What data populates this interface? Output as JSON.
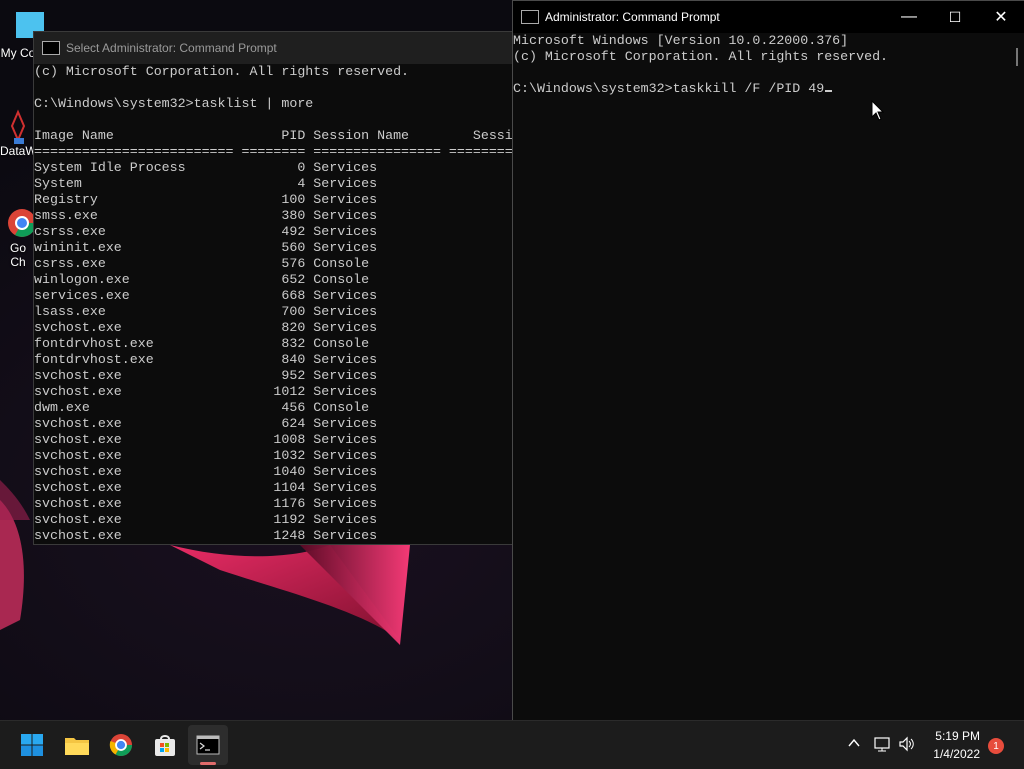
{
  "desktop": {
    "icons": [
      {
        "label": "My Co",
        "icon": "monitor-icon"
      },
      {
        "label": "DataW",
        "icon": "datawrapper-icon"
      },
      {
        "label": "Go",
        "label2": "Ch",
        "icon": "chrome-icon"
      }
    ]
  },
  "back_window": {
    "title": "Select Administrator: Command Prompt",
    "lines": [
      "(c) Microsoft Corporation. All rights reserved.",
      "",
      "C:\\Windows\\system32>tasklist | more",
      "",
      "Image Name                     PID Session Name        Sessi",
      "========================= ======== ================ ========",
      "System Idle Process              0 Services",
      "System                           4 Services",
      "Registry                       100 Services",
      "smss.exe                       380 Services",
      "csrss.exe                      492 Services",
      "wininit.exe                    560 Services",
      "csrss.exe                      576 Console",
      "winlogon.exe                   652 Console",
      "services.exe                   668 Services",
      "lsass.exe                      700 Services",
      "svchost.exe                    820 Services",
      "fontdrvhost.exe                832 Console",
      "fontdrvhost.exe                840 Services",
      "svchost.exe                    952 Services",
      "svchost.exe                   1012 Services",
      "dwm.exe                        456 Console",
      "svchost.exe                    624 Services",
      "svchost.exe                   1008 Services",
      "svchost.exe                   1032 Services",
      "svchost.exe                   1040 Services",
      "svchost.exe                   1104 Services",
      "svchost.exe                   1176 Services",
      "svchost.exe                   1192 Services",
      "svchost.exe                   1248 Services"
    ]
  },
  "front_window": {
    "title": "Administrator: Command Prompt",
    "minimize": "—",
    "maximize": "☐",
    "close": "✕",
    "lines": [
      "Microsoft Windows [Version 10.0.22000.376]",
      "(c) Microsoft Corporation. All rights reserved.",
      "",
      "C:\\Windows\\system32>taskkill /F /PID 49"
    ]
  },
  "taskbar": {
    "apps": [
      "start-icon",
      "file-explorer-icon",
      "chrome-icon",
      "store-icon",
      "command-prompt-icon"
    ],
    "time": "5:19 PM",
    "date": "1/4/2022",
    "notification_count": "1"
  }
}
